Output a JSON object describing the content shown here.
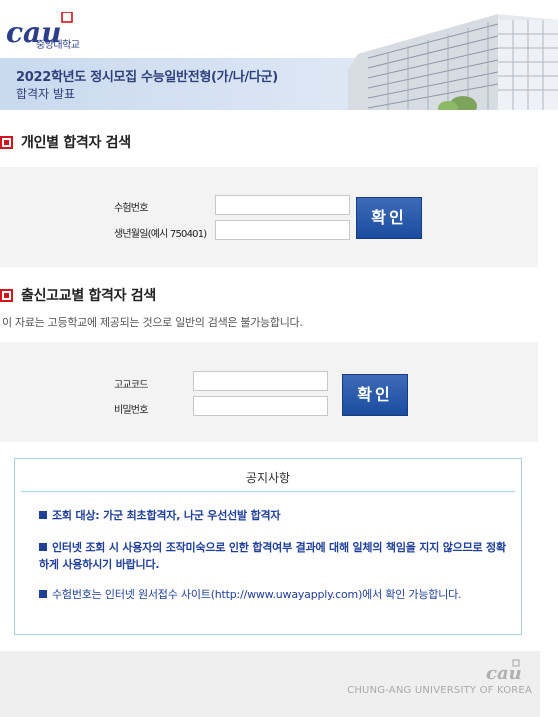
{
  "header": {
    "logo_text": "중앙대학교",
    "title_line1": "2022학년도 정시모집 수능일반전형(가/나/다군)",
    "title_line2": "합격자 발표"
  },
  "individual": {
    "section_title": "개인별 합격자 검색",
    "exam_no_label": "수험번호",
    "exam_no_value": "",
    "birth_label": "생년월일(예시 750401)",
    "birth_value": "",
    "submit_label": "확인"
  },
  "school": {
    "section_title": "출신고교별 합격자 검색",
    "description": "이 자료는 고등학교에 제공되는 것으로 일반의 검색은 불가능합니다.",
    "code_label": "고교코드",
    "code_value": "",
    "password_label": "비밀번호",
    "password_value": "",
    "submit_label": "확인"
  },
  "notice": {
    "title": "공지사항",
    "items": [
      "조회 대상: 가군 최초합격자, 나군 우선선발 합격자",
      "인터넷 조회 시 사용자의 조작미숙으로 인한 합격여부 결과에 대해 일체의 책임을 지지 않으므로 정확하게 사용하시기 바랍니다.",
      "수험번호는 인터넷 원서접수 사이트(http://www.uwayapply.com)에서 확인 가능합니다."
    ]
  },
  "footer": {
    "university": "CHUNG-ANG UNIVERSITY OF KOREA"
  },
  "colors": {
    "brand_blue": "#1b4c9e",
    "notice_blue": "#1f3f99",
    "accent_red": "#d0161c",
    "notice_border": "#a9d4df"
  }
}
